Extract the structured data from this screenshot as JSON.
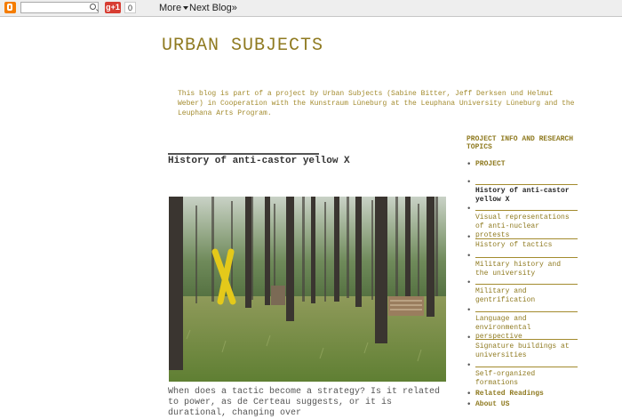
{
  "navbar": {
    "gplus_label": "g+1",
    "gplus_count": "0",
    "more_label": "More",
    "next_blog_label": "Next Blog»"
  },
  "blog": {
    "title": "URBAN SUBJECTS",
    "description": "This blog is part of a project by Urban Subjects (Sabine Bitter, Jeff Derksen und Helmut Weber) in Cooperation with the Kunstraum Lüneburg at the Leuphana University Lüneburg and the Leuphana Arts Program."
  },
  "post": {
    "title": "History of anti-castor yellow X",
    "body": "When does a tactic become a strategy? Is it related to power, as de Certeau suggests, or it is durational, changing over"
  },
  "sidebar": {
    "title": "PROJECT INFO AND RESEARCH TOPICS",
    "project_label": "PROJECT",
    "items": [
      {
        "label": "History of anti-castor yellow X"
      },
      {
        "label": "Visual representations of anti-nuclear protests"
      },
      {
        "label": "History of tactics"
      },
      {
        "label": "Military history and the university"
      },
      {
        "label": "Military and gentrification"
      },
      {
        "label": "Language and environmental perspective"
      },
      {
        "label": "Signature buildings at universities"
      },
      {
        "label": "Self-organized formations"
      }
    ],
    "related_label": "Related Readings",
    "about_label": "About US"
  },
  "colors": {
    "accent": "#8f7a20",
    "navbar_bg": "#eeeeee",
    "blogger_orange": "#f57d00"
  }
}
